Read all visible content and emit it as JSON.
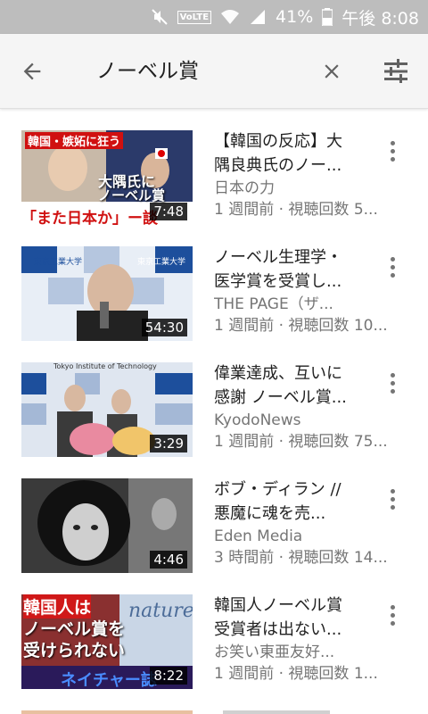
{
  "status_bar": {
    "volte": "VoLTE",
    "battery": "41%",
    "time": "午後 8:08",
    "icons": [
      "mute-icon",
      "volte-icon",
      "wifi-icon",
      "signal-icon",
      "battery-icon"
    ]
  },
  "search": {
    "query": "ノーベル賞"
  },
  "results": [
    {
      "title": "【韓国の反応】大\n隅良典氏のノー...",
      "channel": "日本の力",
      "meta": "1 週間前 · 視聴回数 5...",
      "duration": "7:48",
      "thumb_text": [
        "韓国・嫉妬に狂う",
        "大隅氏に",
        "ノーベル賞",
        "「また日本か」ー談"
      ]
    },
    {
      "title": "ノーベル生理学・\n医学賞を受賞し...",
      "channel": "THE PAGE（ザ...",
      "meta": "1 週間前 · 視聴回数 10...",
      "duration": "54:30",
      "thumb_text": [
        "東京工業大学",
        "東京工業大学"
      ]
    },
    {
      "title": "偉業達成、互いに\n感謝 ノーベル賞...",
      "channel": "KyodoNews",
      "meta": "1 週間前 · 視聴回数 75...",
      "duration": "3:29",
      "thumb_text": [
        "Tokyo Institute of Technology"
      ]
    },
    {
      "title": "ボブ・ディラン //\n悪魔に魂を売...",
      "channel": "Eden Media",
      "meta": "3 時間前 · 視聴回数 14...",
      "duration": "4:46",
      "thumb_text": []
    },
    {
      "title": "韓国人ノーベル賞\n受賞者は出ない...",
      "channel": "お笑い東亜友好...",
      "meta": "1 週間前 · 視聴回数 1...",
      "duration": "8:22",
      "thumb_text": [
        "韓国人は",
        "ノーベル賞を",
        "受けられない",
        "ネイチャー誌",
        "nature"
      ]
    }
  ],
  "colors": {
    "status_bar": "#bdbdbd",
    "app_bar": "#f5f5f5",
    "secondary_text": "#757575"
  }
}
